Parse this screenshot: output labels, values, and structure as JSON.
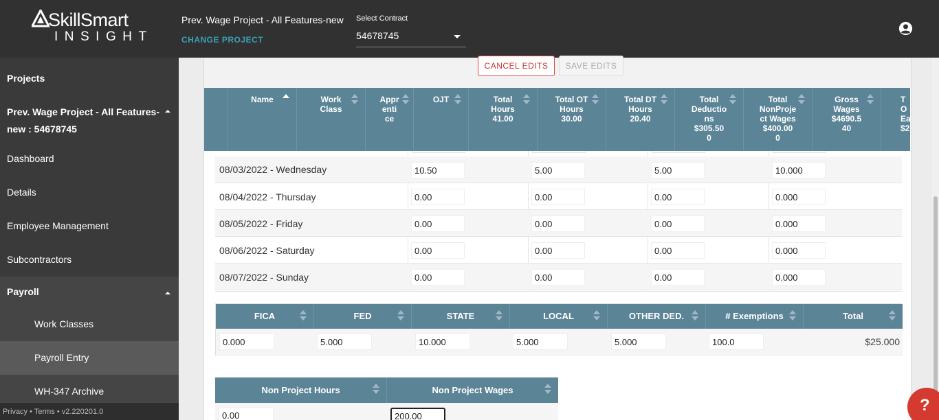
{
  "brand": {
    "name": "SkillSmart",
    "sub": "INSIGHT"
  },
  "header": {
    "project_title": "Prev. Wage Project - All Features-new",
    "change_project": "CHANGE PROJECT",
    "contract_label": "Select Contract",
    "contract_value": "54678745"
  },
  "sidebar": {
    "projects": "Projects",
    "current_project_line1": "Prev. Wage Project - All Features-",
    "current_project_line2": "new : 54678745",
    "dashboard": "Dashboard",
    "details": "Details",
    "employee_management": "Employee Management",
    "subcontractors": "Subcontractors",
    "payroll": "Payroll",
    "work_classes": "Work Classes",
    "payroll_entry": "Payroll Entry",
    "wh347_archive": "WH-347 Archive",
    "footer": "Privacy • Terms • v2.220201.0"
  },
  "toolbar": {
    "cancel": "CANCEL EDITS",
    "save": "SAVE EDITS"
  },
  "grid_headers": [
    {
      "label": "Name",
      "sort": "asc"
    },
    {
      "label": "Work\nClass"
    },
    {
      "label": "Appr\nenti\nce"
    },
    {
      "label": "OJT"
    },
    {
      "label": "Total\nHours\n41.00"
    },
    {
      "label": "Total OT\nHours\n30.00"
    },
    {
      "label": "Total DT\nHours\n20.40"
    },
    {
      "label": "Total\nDeductio\nns\n$305.50\n0"
    },
    {
      "label": "Total\nNonProje\nct Wages\n$400.00\n0"
    },
    {
      "label": "Gross\nWages\n$4690.5\n40"
    },
    {
      "label": "T\nO\nEar\n$2"
    }
  ],
  "daily_rows": [
    {
      "date": "08/03/2022 - Wednesday",
      "reg": "10.50",
      "ot": "5.00",
      "dt": "5.00",
      "rate": "10.000"
    },
    {
      "date": "08/04/2022 - Thursday",
      "reg": "0.00",
      "ot": "0.00",
      "dt": "0.00",
      "rate": "0.000"
    },
    {
      "date": "08/05/2022 - Friday",
      "reg": "0.00",
      "ot": "0.00",
      "dt": "0.00",
      "rate": "0.000"
    },
    {
      "date": "08/06/2022 - Saturday",
      "reg": "0.00",
      "ot": "0.00",
      "dt": "0.00",
      "rate": "0.000"
    },
    {
      "date": "08/07/2022 - Sunday",
      "reg": "0.00",
      "ot": "0.00",
      "dt": "0.00",
      "rate": "0.000"
    }
  ],
  "deductions": {
    "headers": [
      "FICA",
      "FED",
      "STATE",
      "LOCAL",
      "OTHER DED.",
      "# Exemptions",
      "Total"
    ],
    "values": [
      "0.000",
      "5.000",
      "10.000",
      "5.000",
      "5.000",
      "100.0"
    ],
    "total": "$25.000"
  },
  "non_project": {
    "headers": [
      "Non Project Hours",
      "Non Project Wages"
    ],
    "hours": "0.00",
    "wages": "200.00"
  },
  "help": "?"
}
